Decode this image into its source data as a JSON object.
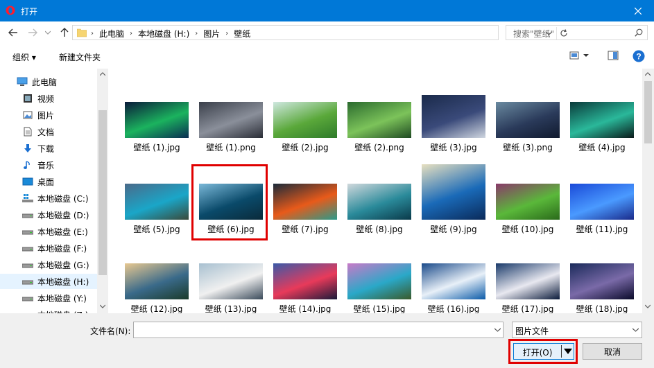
{
  "window": {
    "title": "打开"
  },
  "address": {
    "crumbs": [
      "此电脑",
      "本地磁盘 (H:)",
      "图片",
      "壁纸"
    ],
    "search_placeholder": "搜索\"壁纸\""
  },
  "toolbar": {
    "organize_label": "组织 ▾",
    "new_folder_label": "新建文件夹"
  },
  "sidebar": {
    "items": [
      {
        "label": "此电脑",
        "icon": "computer-icon"
      },
      {
        "label": "视频",
        "icon": "video-icon"
      },
      {
        "label": "图片",
        "icon": "pictures-icon"
      },
      {
        "label": "文档",
        "icon": "document-icon"
      },
      {
        "label": "下载",
        "icon": "download-icon"
      },
      {
        "label": "音乐",
        "icon": "music-icon"
      },
      {
        "label": "桌面",
        "icon": "desktop-icon"
      },
      {
        "label": "本地磁盘 (C:)",
        "icon": "windows-drive-icon"
      },
      {
        "label": "本地磁盘 (D:)",
        "icon": "drive-icon"
      },
      {
        "label": "本地磁盘 (E:)",
        "icon": "drive-icon"
      },
      {
        "label": "本地磁盘 (F:)",
        "icon": "drive-icon"
      },
      {
        "label": "本地磁盘 (G:)",
        "icon": "drive-icon"
      },
      {
        "label": "本地磁盘 (H:)",
        "icon": "drive-icon",
        "selected": true
      },
      {
        "label": "本地磁盘 (Y:)",
        "icon": "drive-icon"
      },
      {
        "label": "本地磁盘 (Z:)",
        "icon": "drive-icon"
      }
    ]
  },
  "files": [
    {
      "name": "壁纸 (1).jpg",
      "colors": [
        "#0a1a3a",
        "#1bb35e",
        "#0a2d52"
      ]
    },
    {
      "name": "壁纸 (1).png",
      "colors": [
        "#3a3f4a",
        "#8a8f9a",
        "#2a2d36"
      ]
    },
    {
      "name": "壁纸 (2).jpg",
      "colors": [
        "#cfe8e0",
        "#5aa83a",
        "#2e7a2a"
      ]
    },
    {
      "name": "壁纸 (2).png",
      "colors": [
        "#2a6a2e",
        "#7cc35a",
        "#1f4a22"
      ]
    },
    {
      "name": "壁纸 (3).jpg",
      "colors": [
        "#1a2a4a",
        "#3a4a7a",
        "#cfd6e0"
      ]
    },
    {
      "name": "壁纸 (3).png",
      "colors": [
        "#6a8aa0",
        "#2a3a5a",
        "#101a2e"
      ]
    },
    {
      "name": "壁纸 (4).jpg",
      "colors": [
        "#0a3a3a",
        "#2ab89a",
        "#0a1a1a"
      ]
    },
    {
      "name": "壁纸 (5).jpg",
      "colors": [
        "#4a6a8a",
        "#1aa6c8",
        "#3a4a3a"
      ]
    },
    {
      "name": "壁纸 (6).jpg",
      "colors": [
        "#7ab8d8",
        "#0a4a6a",
        "#0a2a3a"
      ]
    },
    {
      "name": "壁纸 (7).jpg",
      "colors": [
        "#1a2a3a",
        "#e85a1a",
        "#2a9a8a"
      ]
    },
    {
      "name": "壁纸 (8).jpg",
      "colors": [
        "#d0d8dc",
        "#2a8a9a",
        "#0a3a4a"
      ]
    },
    {
      "name": "壁纸 (9).jpg",
      "colors": [
        "#e8e0c0",
        "#1a6ab8",
        "#0a2a5a"
      ]
    },
    {
      "name": "壁纸 (10).jpg",
      "colors": [
        "#8a3a6a",
        "#5ab83a",
        "#2a6a1a"
      ]
    },
    {
      "name": "壁纸 (11).jpg",
      "colors": [
        "#1a4ad8",
        "#4a9aff",
        "#1a2a8a"
      ]
    },
    {
      "name": "壁纸 (12).jpg",
      "colors": [
        "#e8c890",
        "#3a6a8a",
        "#1a3a2a"
      ]
    },
    {
      "name": "壁纸 (13).jpg",
      "colors": [
        "#a8c0d0",
        "#f0f0f0",
        "#3a4a5a"
      ]
    },
    {
      "name": "壁纸 (14).jpg",
      "colors": [
        "#3a5aa8",
        "#e83a5a",
        "#1a1a3a"
      ]
    },
    {
      "name": "壁纸 (15).jpg",
      "colors": [
        "#c87ac8",
        "#2aa8c8",
        "#3a5a2a"
      ]
    },
    {
      "name": "壁纸 (16).jpg",
      "colors": [
        "#1a4a8a",
        "#e8f0f8",
        "#0a5aa8"
      ]
    },
    {
      "name": "壁纸 (17).jpg",
      "colors": [
        "#1a3a6a",
        "#e8e8f0",
        "#0a1a3a"
      ]
    },
    {
      "name": "壁纸 (18).jpg",
      "colors": [
        "#1a2a5a",
        "#7a6aa8",
        "#0a0a2a"
      ]
    }
  ],
  "footer": {
    "filename_label": "文件名(N):",
    "filename_value": "",
    "filetype_value": "图片文件",
    "open_label": "打开(O)",
    "cancel_label": "取消"
  },
  "colors": {
    "accent": "#0078d7",
    "highlight": "#e00000"
  }
}
